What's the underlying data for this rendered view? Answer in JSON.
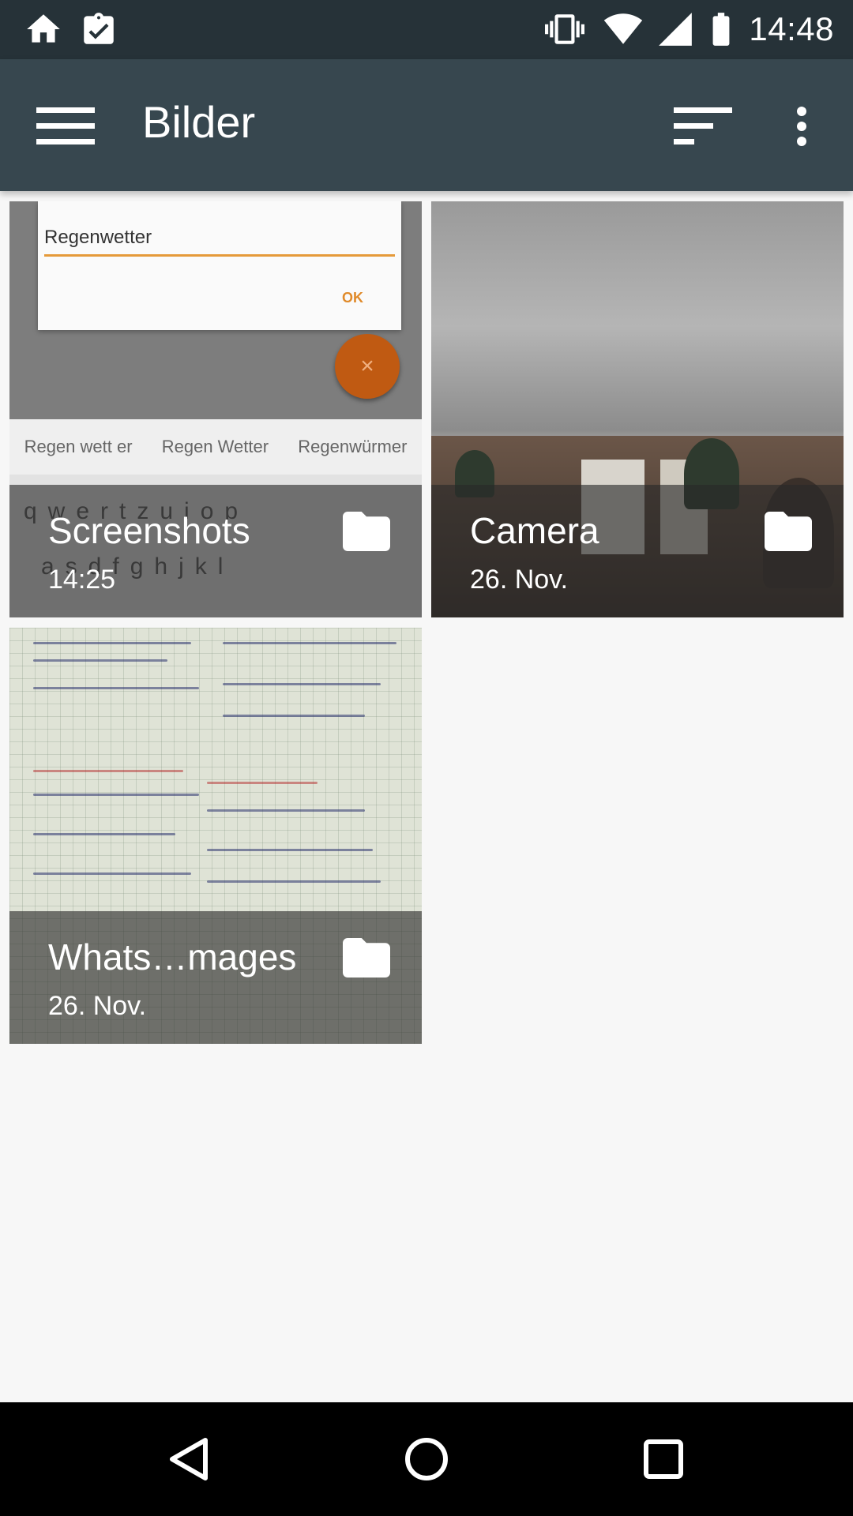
{
  "status_bar": {
    "time": "14:48",
    "icons": [
      "home-icon",
      "clipboard-check-icon",
      "vibrate-icon",
      "wifi-icon",
      "signal-icon",
      "battery-icon"
    ]
  },
  "app_bar": {
    "title": "Bilder",
    "menu_icon": "hamburger-menu-icon",
    "sort_icon": "sort-icon",
    "more_icon": "more-vert-icon"
  },
  "albums": [
    {
      "name": "Screenshots",
      "date": "14:25",
      "thumb": {
        "dialog_field": "Regenwetter",
        "dialog_ok": "OK",
        "suggestions": [
          "Regen wett er",
          "Regen Wetter",
          "Regenwürmer"
        ],
        "keys_row": "qwertzuiop",
        "keys_row2": "asdfghjkl"
      }
    },
    {
      "name": "Camera",
      "date": "26. Nov."
    },
    {
      "name": "Whats…mages",
      "date": "26. Nov."
    }
  ],
  "nav_bar": [
    "back-icon",
    "home-circle-icon",
    "recents-icon"
  ],
  "colors": {
    "status_bar": "#263238",
    "app_bar": "#37474f",
    "background": "#f7f7f7",
    "nav_bar": "#000000"
  }
}
